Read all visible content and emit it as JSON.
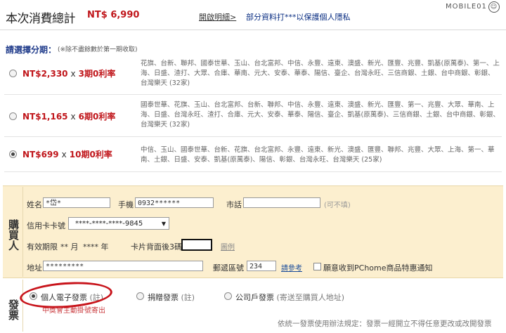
{
  "header": {
    "title": "本次消費總計",
    "amount": "NT$ 6,990",
    "detail_link": "開啟明細>",
    "privacy_note": "部分資料打***以保護個人隱私",
    "logo": "MOBILE01"
  },
  "installment": {
    "title": "請選擇分期：",
    "note": "(※除不盡餘數於第一期收取)",
    "options": [
      {
        "amount": "NT$2,330",
        "times": "x",
        "period": "3期0利率",
        "selected": false,
        "banks": "花旗、台新、聯邦、國泰世華、玉山、台北富邦、中信、永豐、遠東、澳盛、新光、匯豐、兆豐、凱基(原萬泰)、第一、上海、日盛、渣打、大眾、合庫、華南、元大、安泰、華泰、陽信、臺企、台灣永旺、三信商銀、土銀、台中商銀、彰銀、台灣樂天 (32家)"
      },
      {
        "amount": "NT$1,165",
        "times": "x",
        "period": "6期0利率",
        "selected": false,
        "banks": "國泰世華、花旗、玉山、台北富邦、台新、聯邦、中信、永豐、遠東、澳盛、新光、匯豐、第一、兆豐、大眾、華南、上海、日盛、台灣永旺、渣打、合庫、元大、安泰、華泰、陽信、臺企、凱基(原萬泰)、三信商銀、土銀、台中商銀、彰銀、台灣樂天 (32家)"
      },
      {
        "amount": "NT$699",
        "times": "x",
        "period": "10期0利率",
        "selected": true,
        "banks": "中信、玉山、國泰世華、台新、花旗、台北富邦、永豐、遠東、新光、澳盛、匯豐、聯邦、兆豐、大眾、上海、第一、華南、土銀、日盛、安泰、凱基(原萬泰)、陽信、彰銀、台灣永旺、台灣樂天 (25家)"
      }
    ]
  },
  "buyer": {
    "section_label": "購買人",
    "name_label": "姓名",
    "name_value": "*岱*",
    "mobile_label": "手機",
    "mobile_value": "0932******",
    "phone_label": "市話",
    "phone_value": "",
    "phone_hint": "(可不填)",
    "card_label": "信用卡卡號",
    "card_value": "****-****-****-9845",
    "card_arrow": "▼",
    "expiry_label": "有效期限",
    "expiry_month": "** 月",
    "expiry_year": "**** 年",
    "cvv_label": "卡片背面後3碼",
    "cvv_value": "",
    "cvv_example": "圖例",
    "address_label": "地址",
    "address_value": "*********",
    "zip_label": "郵遞區號",
    "zip_value": "234",
    "zip_link": "請參考",
    "newsletter_label": "願意收到PChome商品特惠通知"
  },
  "invoice": {
    "section_label": "發票",
    "options": [
      {
        "label": "個人電子發票",
        "note": "(註)",
        "selected": true
      },
      {
        "label": "捐贈發票",
        "note": "(註)",
        "selected": false
      },
      {
        "label": "公司戶發票",
        "note": "(寄送至購買人地址)",
        "selected": false
      }
    ],
    "red_note": "中獎會主動掛號寄出",
    "footer_note": "依統一發票使用辦法規定：發票一經開立不得任意更改或改開發票"
  },
  "colors": {
    "price_red": "#c0161b",
    "title_blue": "#1e3a8a",
    "buyer_bg": "#fcefcf",
    "oval_red": "#c8141b"
  }
}
